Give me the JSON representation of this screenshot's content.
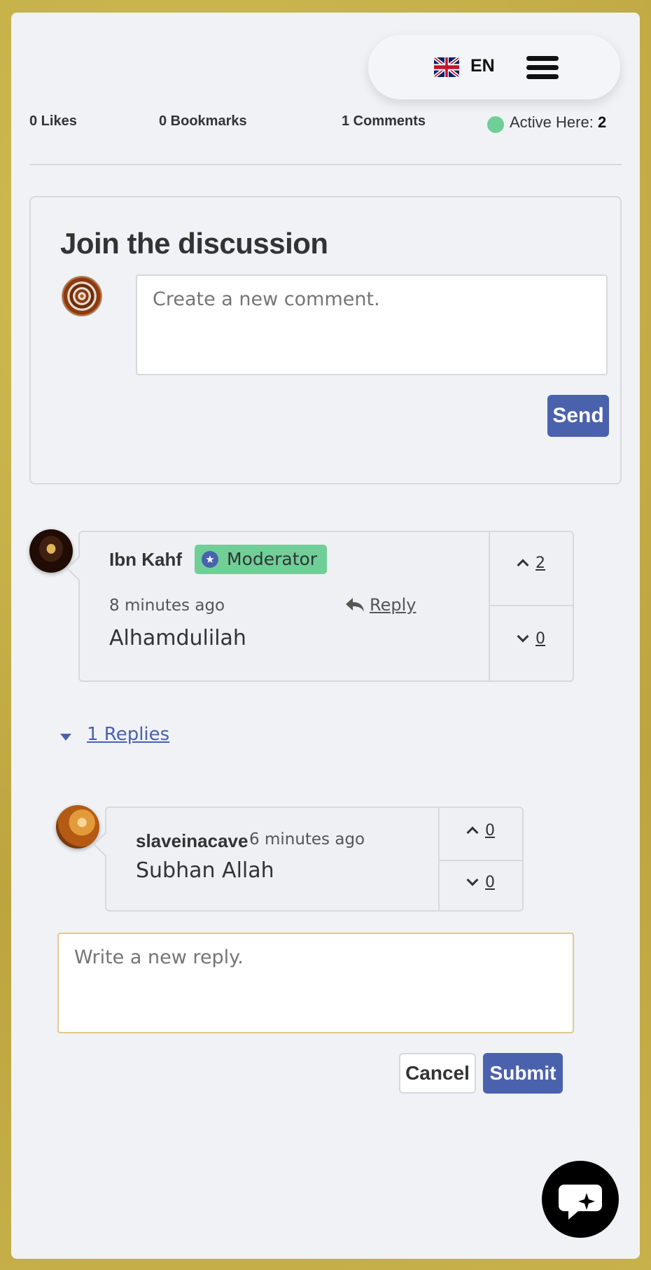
{
  "header": {
    "language": "EN"
  },
  "stats": {
    "likes": "0 Likes",
    "bookmarks": "0 Bookmarks",
    "comments": "1 Comments",
    "active_label": "Active Here:",
    "active_count": "2"
  },
  "discussion": {
    "title": "Join the discussion",
    "comment_placeholder": "Create a new comment.",
    "send_label": "Send"
  },
  "comment": {
    "author": "Ibn Kahf",
    "badge": "Moderator",
    "time": "8 minutes ago",
    "reply_label": "Reply",
    "text": "Alhamdulilah",
    "upvotes": "2",
    "downvotes": "0"
  },
  "replies_toggle": "1 Replies",
  "reply": {
    "author": "slaveinacave",
    "time": "6 minutes ago",
    "text": "Subhan Allah",
    "upvotes": "0",
    "downvotes": "0"
  },
  "reply_form": {
    "placeholder": "Write a new reply.",
    "cancel_label": "Cancel",
    "submit_label": "Submit"
  },
  "colors": {
    "accent": "#4a62ad",
    "badge": "#6fcf97",
    "active_dot": "#6fcf97"
  }
}
